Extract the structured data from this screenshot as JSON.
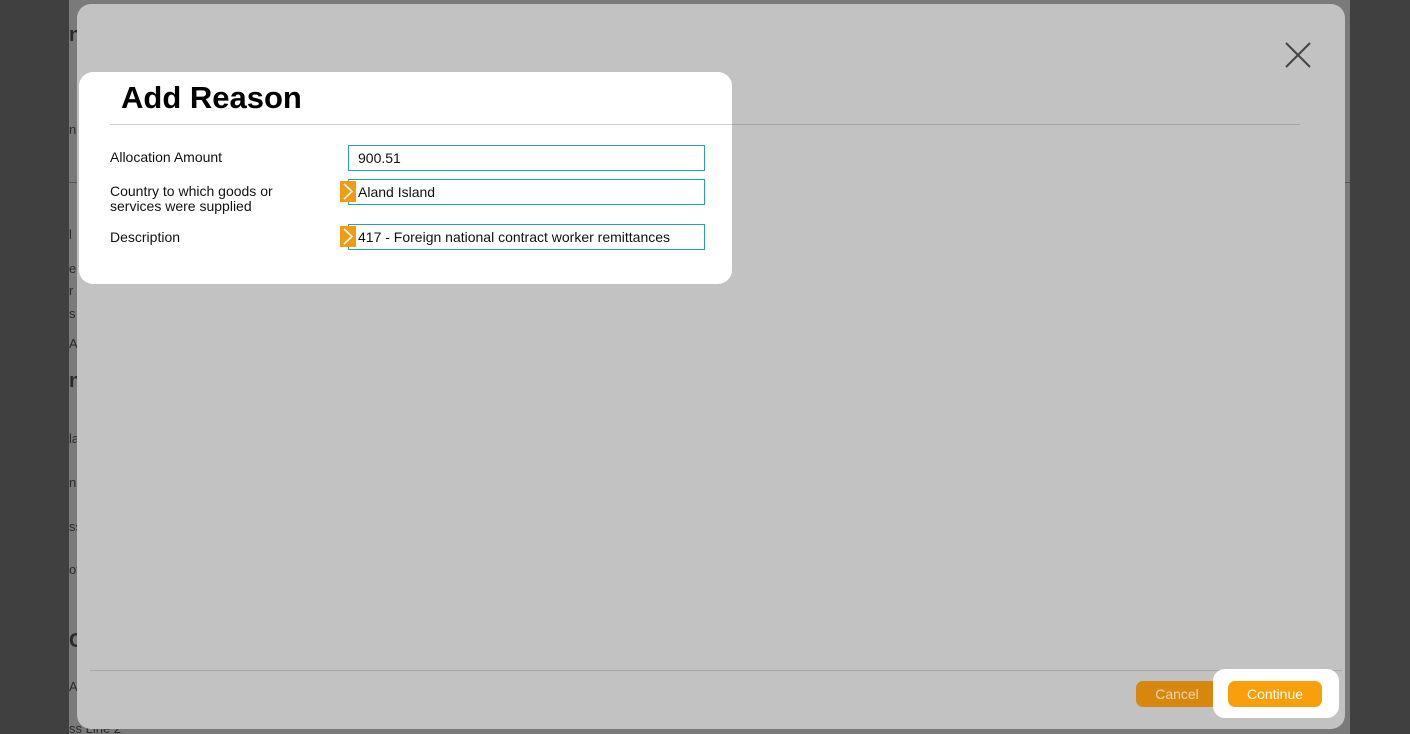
{
  "background": {
    "fragments": [
      "n",
      "n",
      "l",
      "e",
      "r",
      "s",
      "A",
      "n",
      "la",
      "n",
      "ss",
      "of",
      "C",
      "A",
      "ss Line 2"
    ]
  },
  "dialog": {
    "title": "Add Reason",
    "close_icon": "close-x-icon",
    "fields": {
      "allocation_amount": {
        "label": "Allocation Amount",
        "value": "900.51"
      },
      "country": {
        "label_line1": "Country to which goods or",
        "label_line2": "services were supplied",
        "value": "Aland Island",
        "icon": "chevron-right-icon"
      },
      "description": {
        "label": "Description",
        "value": "417 - Foreign national contract worker remittances",
        "icon": "chevron-right-icon"
      }
    },
    "buttons": {
      "cancel": "Cancel",
      "continue": "Continue"
    }
  },
  "colors": {
    "accent": "#fa9f0c",
    "input_border": "#2aa3a8",
    "overlay": "#c2c2c2"
  }
}
